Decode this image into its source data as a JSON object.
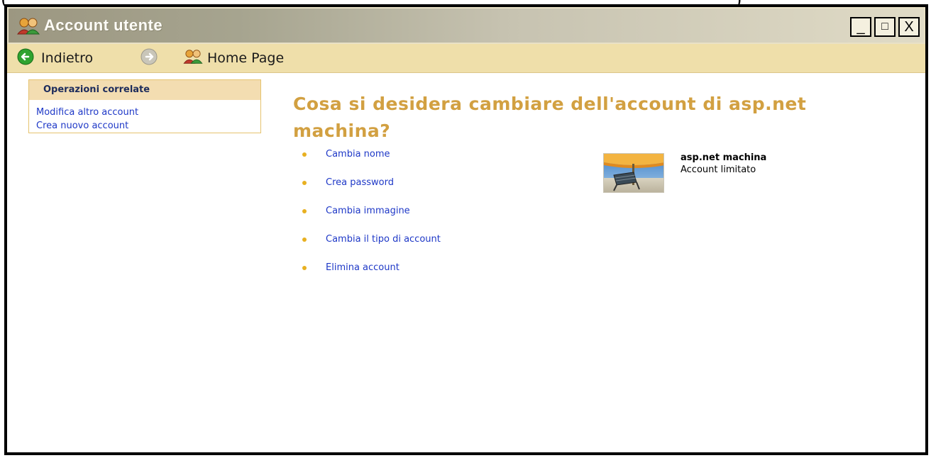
{
  "window": {
    "title": "Account utente",
    "controls": {
      "minimize": "_",
      "maximize": "□",
      "close": "X"
    }
  },
  "top_clip": {
    "left": "(",
    "right": ")"
  },
  "nav": {
    "back_label": "Indietro",
    "home_label": "Home Page",
    "icons": [
      "back-arrow-icon",
      "forward-arrow-icon",
      "users-icon"
    ]
  },
  "sidebar": {
    "title": "Operazioni correlate",
    "links": [
      {
        "label": "Modifica altro account"
      },
      {
        "label": "Crea nuovo account"
      }
    ]
  },
  "main": {
    "heading": "Cosa si desidera cambiare dell'account di asp.net machina?",
    "tasks": [
      {
        "label": "Cambia nome"
      },
      {
        "label": "Crea password"
      },
      {
        "label": "Cambia immagine"
      },
      {
        "label": "Cambia il tipo di account"
      },
      {
        "label": "Elimina account"
      }
    ]
  },
  "account": {
    "name": "asp.net machina",
    "type": "Account limitato",
    "picture_icon": "beach-chair-picture"
  },
  "colors": {
    "heading": "#d2a041",
    "link": "#1e38c7",
    "bullet": "#e8b021",
    "navbar": "#efdfaa",
    "side_header": "#f3ddb1"
  }
}
